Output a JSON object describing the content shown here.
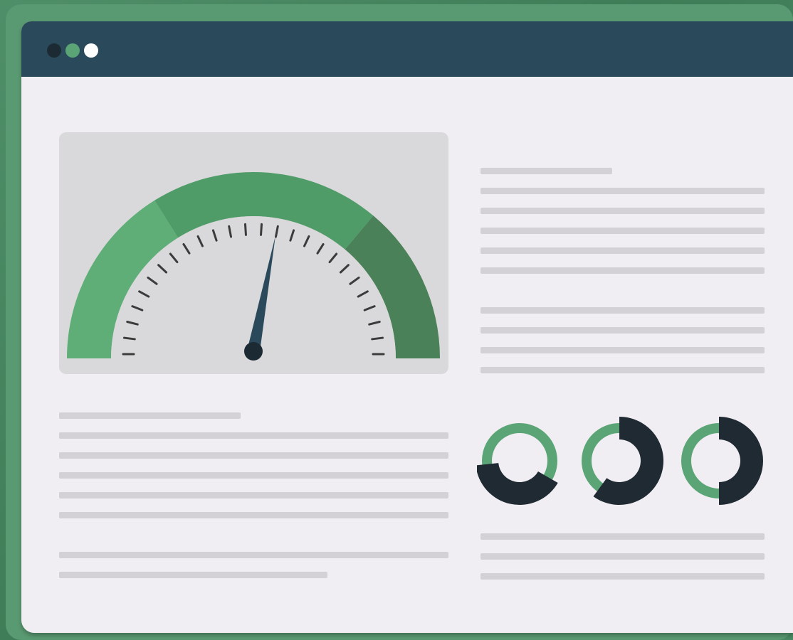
{
  "window": {
    "controls": [
      "close",
      "minimize",
      "maximize"
    ]
  },
  "gauge": {
    "value_fraction": 0.56,
    "colors": {
      "arc_left": "#5fae78",
      "arc_middle": "#4f9c68",
      "arc_right": "#4a8158",
      "needle": "#2a4a5c",
      "hub": "#1c2a33",
      "ticks": "#3b3b3b",
      "panel": "#d9d8da"
    }
  },
  "donuts": [
    {
      "dark_fraction": 0.4
    },
    {
      "dark_fraction": 0.6
    },
    {
      "dark_fraction": 0.5
    }
  ],
  "colors": {
    "background": "#4a8a63",
    "window": "#f1eef3",
    "titlebar": "#2a4a5c",
    "placeholder_lines": "#d4d1d6",
    "donut_green": "#5aa476",
    "donut_dark": "#1f2a33"
  }
}
